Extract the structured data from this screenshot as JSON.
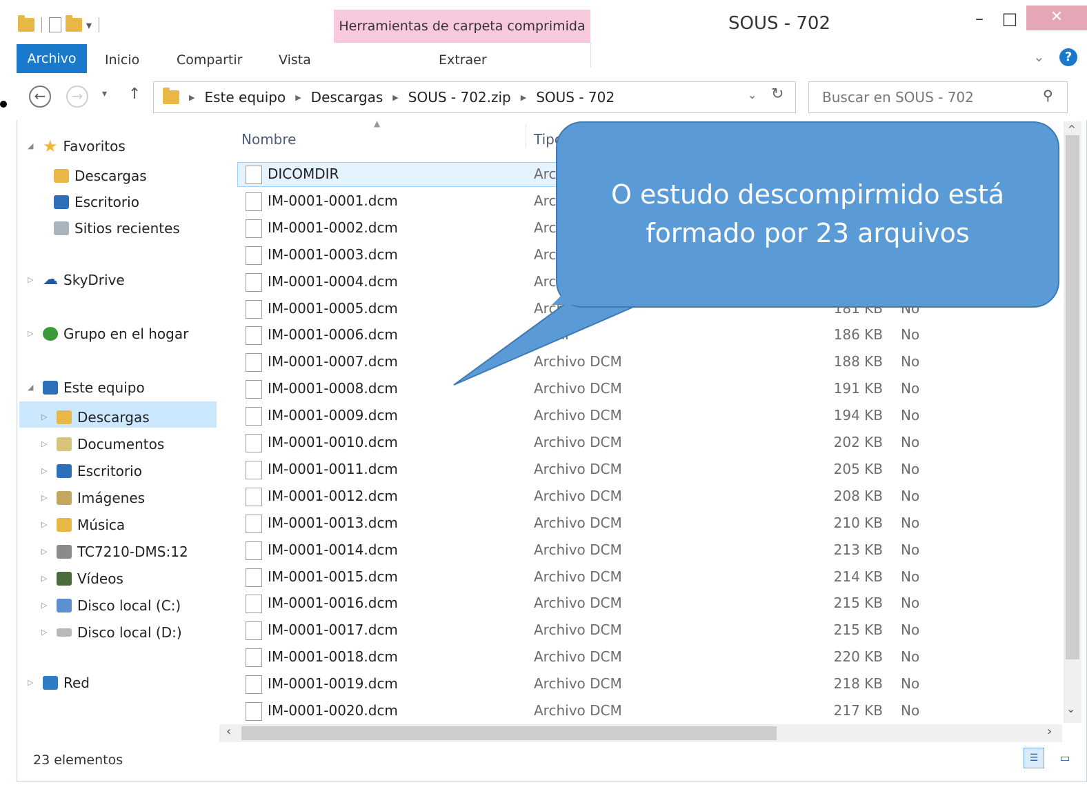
{
  "window": {
    "title": "SOUS - 702",
    "contextual_tab": "Herramientas de carpeta comprimida",
    "minimize": "–",
    "maximize": "□",
    "close": "✕"
  },
  "ribbon": {
    "tabs": [
      "Archivo",
      "Inicio",
      "Compartir",
      "Vista"
    ],
    "contextual_subtab": "Extraer",
    "help": "?",
    "collapse": "⌄"
  },
  "address": {
    "crumbs": [
      "Este equipo",
      "Descargas",
      "SOUS - 702.zip",
      "SOUS - 702"
    ],
    "search_placeholder": "Buscar en SOUS - 702"
  },
  "sidebar": {
    "favorites_label": "Favoritos",
    "favorites": [
      "Descargas",
      "Escritorio",
      "Sitios recientes"
    ],
    "skydrive": "SkyDrive",
    "homegroup": "Grupo en el hogar",
    "this_pc": "Este equipo",
    "this_pc_items": [
      "Descargas",
      "Documentos",
      "Escritorio",
      "Imágenes",
      "Música",
      "TC7210-DMS:12",
      "Vídeos",
      "Disco local (C:)",
      "Disco local (D:)"
    ],
    "network": "Red"
  },
  "columns": {
    "name": "Nombre",
    "type": "Tipo"
  },
  "files": [
    {
      "name": "DICOMDIR",
      "type": "Arc",
      "size": "",
      "compressed": ""
    },
    {
      "name": "IM-0001-0001.dcm",
      "type": "Arc",
      "size": "",
      "compressed": ""
    },
    {
      "name": "IM-0001-0002.dcm",
      "type": "Arc",
      "size": "",
      "compressed": ""
    },
    {
      "name": "IM-0001-0003.dcm",
      "type": "Arc",
      "size": "",
      "compressed": ""
    },
    {
      "name": "IM-0001-0004.dcm",
      "type": "Arc",
      "size": "",
      "compressed": ""
    },
    {
      "name": "IM-0001-0005.dcm",
      "type": "Archivo DCM",
      "size": "181 KB",
      "compressed": "No"
    },
    {
      "name": "IM-0001-0006.dcm",
      "type": "Archi",
      "size": "186 KB",
      "compressed": "No"
    },
    {
      "name": "IM-0001-0007.dcm",
      "type": "Archivo DCM",
      "size": "188 KB",
      "compressed": "No"
    },
    {
      "name": "IM-0001-0008.dcm",
      "type": "Archivo DCM",
      "size": "191 KB",
      "compressed": "No"
    },
    {
      "name": "IM-0001-0009.dcm",
      "type": "Archivo DCM",
      "size": "194 KB",
      "compressed": "No"
    },
    {
      "name": "IM-0001-0010.dcm",
      "type": "Archivo DCM",
      "size": "202 KB",
      "compressed": "No"
    },
    {
      "name": "IM-0001-0011.dcm",
      "type": "Archivo DCM",
      "size": "205 KB",
      "compressed": "No"
    },
    {
      "name": "IM-0001-0012.dcm",
      "type": "Archivo DCM",
      "size": "208 KB",
      "compressed": "No"
    },
    {
      "name": "IM-0001-0013.dcm",
      "type": "Archivo DCM",
      "size": "210 KB",
      "compressed": "No"
    },
    {
      "name": "IM-0001-0014.dcm",
      "type": "Archivo DCM",
      "size": "213 KB",
      "compressed": "No"
    },
    {
      "name": "IM-0001-0015.dcm",
      "type": "Archivo DCM",
      "size": "214 KB",
      "compressed": "No"
    },
    {
      "name": "IM-0001-0016.dcm",
      "type": "Archivo DCM",
      "size": "215 KB",
      "compressed": "No"
    },
    {
      "name": "IM-0001-0017.dcm",
      "type": "Archivo DCM",
      "size": "215 KB",
      "compressed": "No"
    },
    {
      "name": "IM-0001-0018.dcm",
      "type": "Archivo DCM",
      "size": "220 KB",
      "compressed": "No"
    },
    {
      "name": "IM-0001-0019.dcm",
      "type": "Archivo DCM",
      "size": "218 KB",
      "compressed": "No"
    },
    {
      "name": "IM-0001-0020.dcm",
      "type": "Archivo DCM",
      "size": "217 KB",
      "compressed": "No"
    }
  ],
  "status": {
    "count": "23 elementos"
  },
  "callout": {
    "line1": "O estudo descompirmido está",
    "line2": "formado por 23 arquivos"
  },
  "colors": {
    "accent": "#1979ca",
    "contextual_tab": "#f8c8dc",
    "callout": "#5a9ad6",
    "selection": "#cce8ff"
  }
}
